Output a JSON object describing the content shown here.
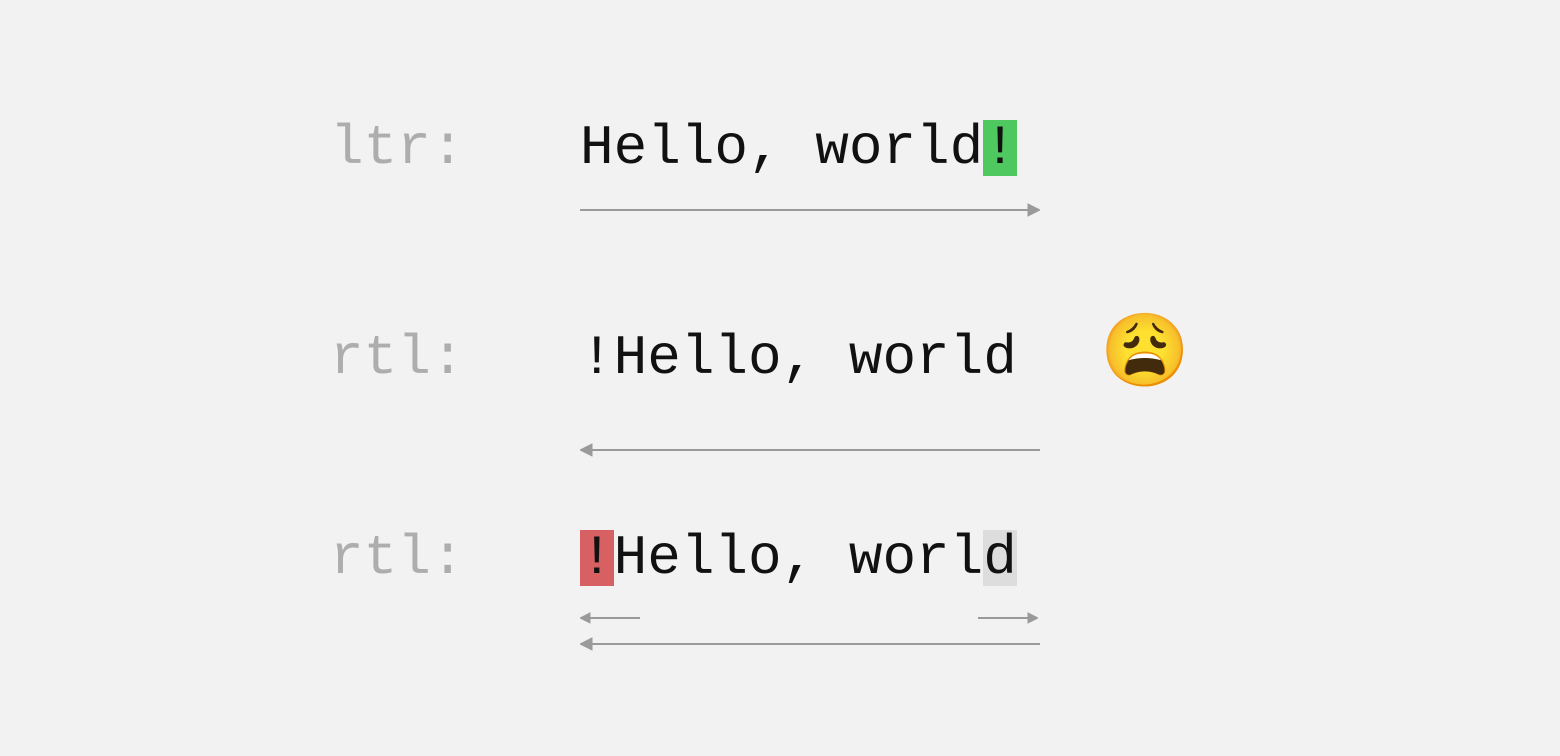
{
  "rows": [
    {
      "label": "ltr:",
      "text_plain": "Hello, world",
      "bang": "!",
      "highlight": "green",
      "bang_position": "end"
    },
    {
      "label": "rtl:",
      "text_plain": "!Hello, world",
      "bang": "",
      "highlight": "none",
      "bang_position": "none"
    },
    {
      "label": "rtl:",
      "text_plain": "Hello, worl",
      "bang": "!",
      "last_char": "d",
      "highlight": "red-gray",
      "bang_position": "start"
    }
  ],
  "emoji": "😩",
  "colors": {
    "highlight_green": "#4fc95f",
    "highlight_red": "#d76062",
    "highlight_gray": "#dddddd",
    "label_gray": "#adadad",
    "arrow_gray": "#9a9a9a",
    "bg": "#f2f2f2"
  }
}
